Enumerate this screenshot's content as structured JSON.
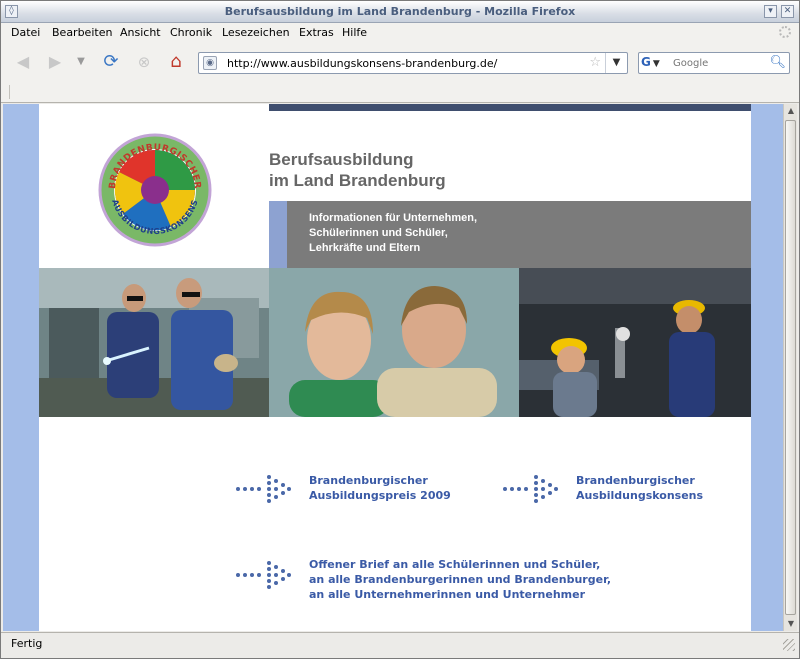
{
  "window": {
    "title": "Berufsausbildung im Land Brandenburg - Mozilla Firefox"
  },
  "menu": {
    "items": [
      "Datei",
      "Bearbeiten",
      "Ansicht",
      "Chronik",
      "Lesezeichen",
      "Extras",
      "Hilfe"
    ]
  },
  "toolbar": {
    "url": "http://www.ausbildungskonsens-brandenburg.de/",
    "search_placeholder": "Google",
    "search_engine": "G"
  },
  "page": {
    "logo_text_top": "BRANDENBURGISCHER",
    "logo_text_bottom": "AUSBILDUNGSKONSENS",
    "headline_line1": "Berufsausbildung",
    "headline_line2": "im Land Brandenburg",
    "info_line1": "Informationen für Unternehmen,",
    "info_line2": "Schülerinnen und Schüler,",
    "info_line3": "Lehrkräfte und Eltern",
    "links": [
      {
        "line1": "Brandenburgischer",
        "line2": "Ausbildungspreis 2009"
      },
      {
        "line1": "Brandenburgischer",
        "line2": "Ausbildungskonsens"
      },
      {
        "line1": "Offener Brief an alle Schülerinnen und Schüler,",
        "line2": "an alle Brandenburgerinnen und Brandenburger,",
        "line3": "an alle Unternehmerinnen und Unternehmer"
      }
    ]
  },
  "status": {
    "text": "Fertig"
  },
  "colors": {
    "link": "#3a5aa6",
    "info_box": "#7b7b7b",
    "page_background": "#a4bde8"
  }
}
